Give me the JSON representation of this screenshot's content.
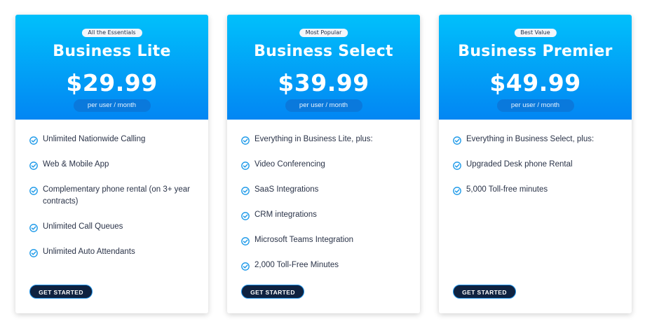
{
  "plans": [
    {
      "badge": "All the Essentials",
      "name": "Business Lite",
      "price": "$29.99",
      "per_unit": "per user / month",
      "features": [
        "Unlimited Nationwide Calling",
        "Web & Mobile App",
        "Complementary phone rental (on 3+ year contracts)",
        "Unlimited Call Queues",
        "Unlimited Auto Attendants"
      ],
      "cta": "GET STARTED"
    },
    {
      "badge": "Most Popular",
      "name": "Business Select",
      "price": "$39.99",
      "per_unit": "per user / month",
      "features": [
        "Everything in Business Lite, plus:",
        "Video Conferencing",
        "SaaS Integrations",
        "CRM integrations",
        "Microsoft Teams Integration",
        "2,000 Toll-Free Minutes"
      ],
      "cta": "GET STARTED"
    },
    {
      "badge": "Best Value",
      "name": "Business Premier",
      "price": "$49.99",
      "per_unit": "per user / month",
      "features": [
        "Everything in Business Select, plus:",
        "Upgraded Desk phone Rental",
        "5,000 Toll-free minutes"
      ],
      "cta": "GET STARTED"
    }
  ],
  "colors": {
    "header_top": "#01c0fb",
    "header_bottom": "#0286f3",
    "check": "#1596e8",
    "button_bg": "#0f2240"
  },
  "icons": {
    "feature": "check-circle-icon"
  }
}
